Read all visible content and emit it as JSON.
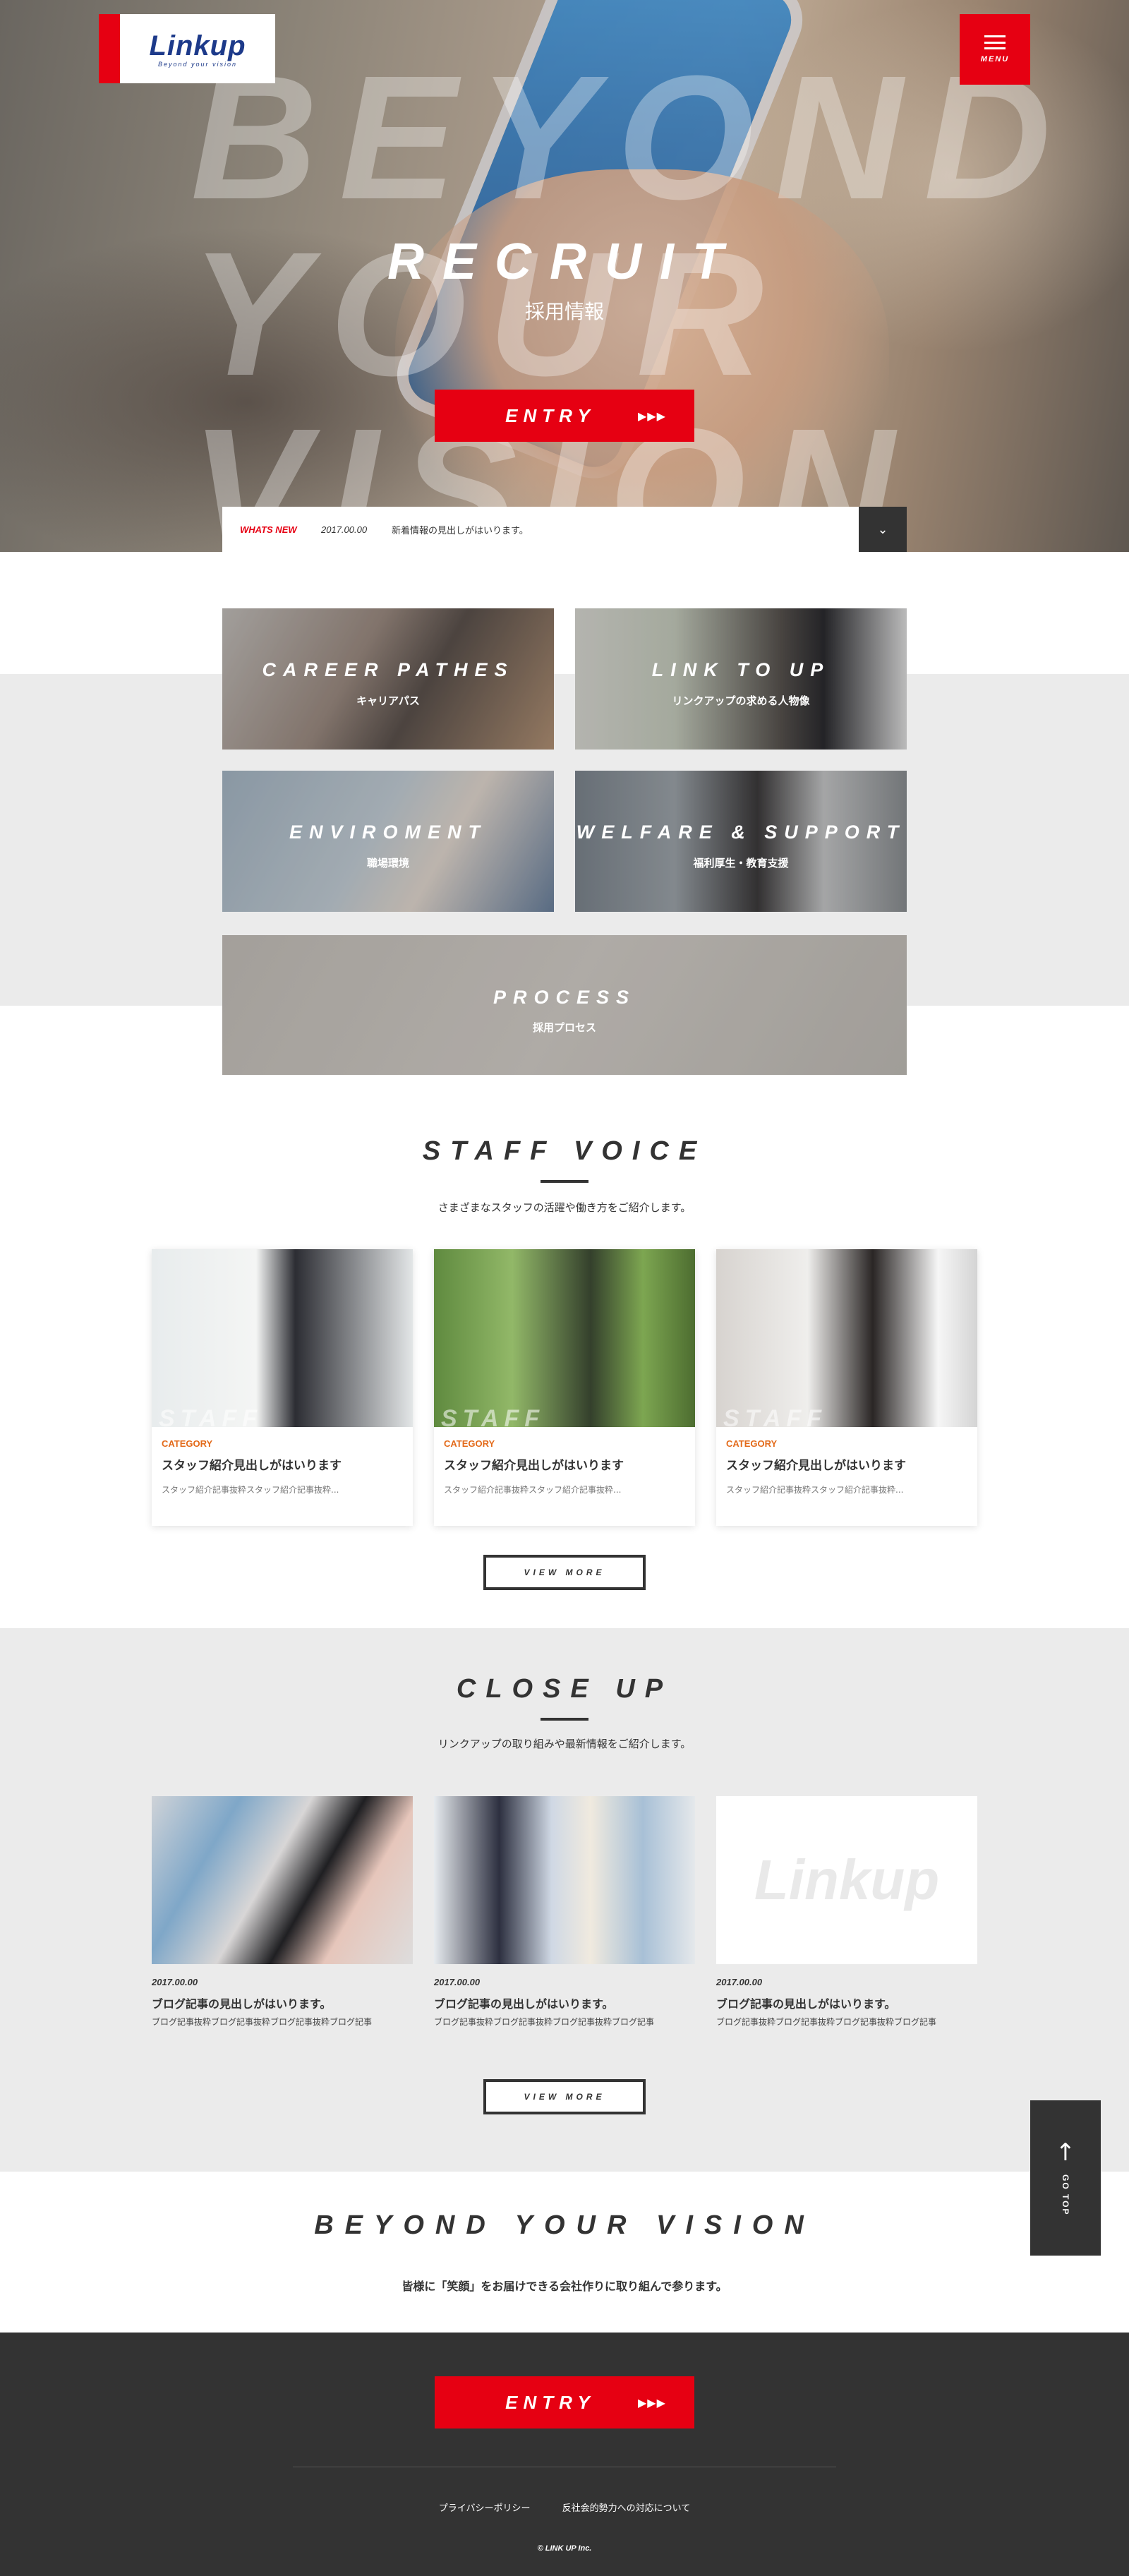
{
  "colors": {
    "accent": "#e60012",
    "dark": "#333333",
    "logo_blue": "#1d3a8a",
    "category": "#e36a1a"
  },
  "header": {
    "logo_name": "Linkup",
    "logo_tagline": "Beyond your vision",
    "menu_label": "MENU",
    "menu_icon": "hamburger-icon"
  },
  "hero": {
    "bg_lines": [
      "BEYOND",
      "YOUR",
      "VISION"
    ],
    "title": "RECRUIT",
    "subtitle": "採用情報",
    "entry_label": "ENTRY",
    "entry_icon": "triple-arrow-icon"
  },
  "news": {
    "tag": "WHATS NEW",
    "date": "2017.00.00",
    "text": "新着情報の見出しがはいります。",
    "toggle_icon": "chevron-down-icon"
  },
  "categories": [
    {
      "title": "CAREER PATHES",
      "sub": "キャリアパス"
    },
    {
      "title": "LINK TO UP",
      "sub": "リンクアップの求める人物像"
    },
    {
      "title": "ENVIROMENT",
      "sub": "職場環境"
    },
    {
      "title": "WELFARE & SUPPORT",
      "sub": "福利厚生・教育支援"
    },
    {
      "title": "PROCESS",
      "sub": "採用プロセス"
    }
  ],
  "staff": {
    "title": "STAFF VOICE",
    "desc": "さまざまなスタッフの活躍や働き方をご紹介します。",
    "watermark": "STAFF",
    "cards": [
      {
        "category": "CATEGORY",
        "heading": "スタッフ紹介見出しがはいります",
        "excerpt": "スタッフ紹介記事抜粋スタッフ紹介記事抜粋..."
      },
      {
        "category": "CATEGORY",
        "heading": "スタッフ紹介見出しがはいります",
        "excerpt": "スタッフ紹介記事抜粋スタッフ紹介記事抜粋..."
      },
      {
        "category": "CATEGORY",
        "heading": "スタッフ紹介見出しがはいります",
        "excerpt": "スタッフ紹介記事抜粋スタッフ紹介記事抜粋..."
      }
    ],
    "more_label": "VIEW MORE"
  },
  "closeup": {
    "title": "CLOSE UP",
    "desc": "リンクアップの取り組みや最新情報をご紹介します。",
    "posts": [
      {
        "date": "2017.00.00",
        "heading": "ブログ記事の見出しがはいります。",
        "excerpt": "ブログ記事抜粋ブログ記事抜粋ブログ記事抜粋ブログ記事"
      },
      {
        "date": "2017.00.00",
        "heading": "ブログ記事の見出しがはいります。",
        "excerpt": "ブログ記事抜粋ブログ記事抜粋ブログ記事抜粋ブログ記事"
      },
      {
        "date": "2017.00.00",
        "heading": "ブログ記事の見出しがはいります。",
        "excerpt": "ブログ記事抜粋ブログ記事抜粋ブログ記事抜粋ブログ記事"
      }
    ],
    "placeholder_logo": "Linkup",
    "more_label": "VIEW MORE"
  },
  "gotop": {
    "label": "GO TOP",
    "icon": "arrow-up-icon"
  },
  "vision": {
    "title": "BEYOND YOUR VISION",
    "desc": "皆様に「笑顔」をお届けできる会社作りに取り組んで参ります。"
  },
  "footer": {
    "entry_label": "ENTRY",
    "links": [
      "プライバシーポリシー",
      "反社会的勢力への対応について"
    ],
    "copyright": "© LINK UP Inc."
  }
}
